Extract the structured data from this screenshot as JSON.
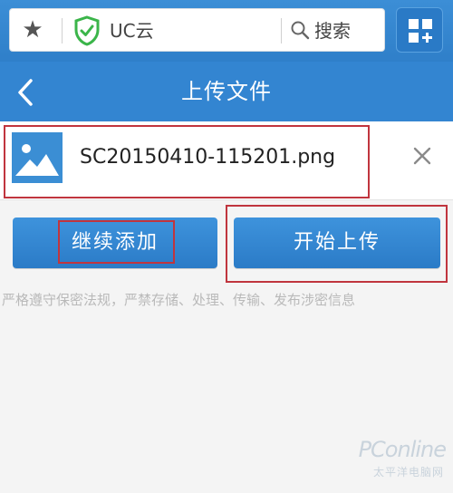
{
  "browser": {
    "address_label": "UC云",
    "search_label": "搜索",
    "icons": {
      "bookmark": "star-icon",
      "security": "shield-check-icon",
      "search": "search-icon",
      "apps": "apps-grid-icon"
    }
  },
  "header": {
    "title": "上传文件",
    "back_icon": "chevron-left-icon"
  },
  "file": {
    "name": "SC20150410-115201.png",
    "thumb_icon": "image-icon",
    "remove_icon": "close-icon"
  },
  "actions": {
    "continue_label": "继续添加",
    "start_label": "开始上传"
  },
  "notice": "严格遵守保密法规，严禁存储、处理、传输、发布涉密信息",
  "watermark": {
    "brand": "PConline",
    "sub": "太平洋电脑网"
  },
  "colors": {
    "header_blue": "#3385d1",
    "button_blue": "#2b7bc7",
    "highlight_red": "#c0353e",
    "shield_green": "#3bb54a"
  }
}
